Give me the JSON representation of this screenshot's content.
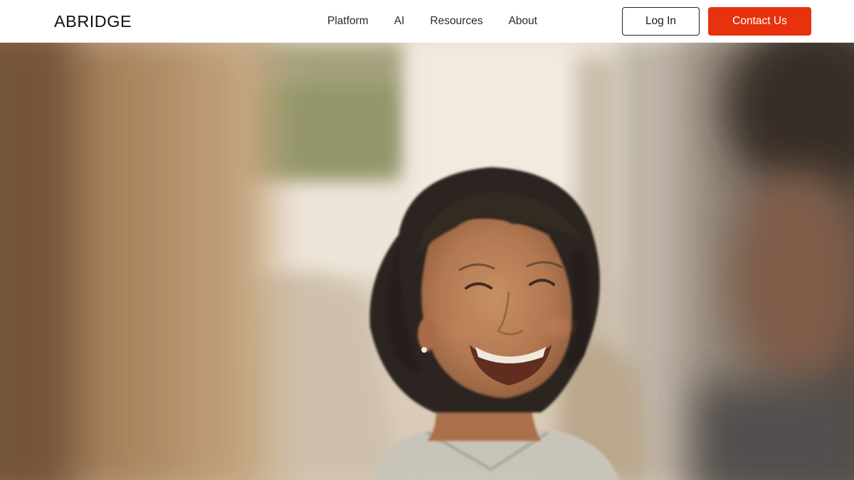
{
  "header": {
    "logo_text": "ABRIDGE",
    "nav": [
      "Platform",
      "AI",
      "Resources",
      "About"
    ],
    "login_label": "Log In",
    "contact_label": "Contact Us",
    "accent_color": "#e8320e"
  },
  "hero": {
    "image_description_icon": "photo-smiling-woman"
  }
}
